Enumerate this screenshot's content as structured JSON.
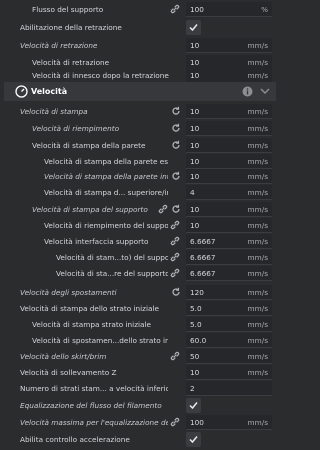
{
  "top": {
    "label": "Flusso del supporto",
    "value": "100",
    "unit": "%"
  },
  "retraction": {
    "enable_label": "Abilitazione della retrazione",
    "speed_label": "Velocità di retrazione",
    "speed_value": "10",
    "speed_unit": "mm/s",
    "retract_speed_label": "Velocità di retrazione",
    "retract_speed_value": "10",
    "retract_speed_unit": "mm/s",
    "prime_speed_label": "Velocità di innesco dopo la retrazione",
    "prime_speed_value": "10",
    "prime_speed_unit": "mm/s"
  },
  "category": {
    "title": "Velocità"
  },
  "settings": [
    {
      "label": "Velocità di stampa",
      "value": "10",
      "unit": "mm/s"
    },
    {
      "label": "Velocità di riempimento",
      "value": "10",
      "unit": "mm/s"
    },
    {
      "label": "Velocità di stampa della parete",
      "value": "10",
      "unit": "mm/s"
    },
    {
      "label": "Velocità di stampa della parete esterna",
      "value": "10",
      "unit": "mm/s"
    },
    {
      "label": "Velocità di stampa della parete interna",
      "value": "10",
      "unit": "mm/s"
    },
    {
      "label": "Velocità di stampa d... superiore/inferiore",
      "value": "4",
      "unit": "mm/s"
    },
    {
      "label": "Velocità di stampa del supporto",
      "value": "10",
      "unit": "mm/s"
    },
    {
      "label": "Velocità di riempimento del supporto",
      "value": "10",
      "unit": "mm/s"
    },
    {
      "label": "Velocità interfaccia supporto",
      "value": "6.6667",
      "unit": "mm/s"
    },
    {
      "label": "Velocità di stam...to) del supporto",
      "value": "6.6667",
      "unit": "mm/s"
    },
    {
      "label": "Velocità di sta...re del supporto",
      "value": "6.6667",
      "unit": "mm/s"
    },
    {
      "label": "Velocità degli spostamenti",
      "value": "120",
      "unit": "mm/s"
    },
    {
      "label": "Velocità di stampa dello strato iniziale",
      "value": "5.0",
      "unit": "mm/s"
    },
    {
      "label": "Velocità di stampa strato iniziale",
      "value": "5.0",
      "unit": "mm/s"
    },
    {
      "label": "Velocità di spostamen...dello strato iniziale",
      "value": "60.0",
      "unit": "mm/s"
    },
    {
      "label": "Velocità dello skirt/brim",
      "value": "50",
      "unit": "mm/s"
    },
    {
      "label": "Velocità di sollevamento Z",
      "value": "10",
      "unit": "mm/s"
    },
    {
      "label": "Numero di strati stam... a velocità inferiore",
      "value": "2",
      "unit": ""
    },
    {
      "label": "Equalizzazione del flusso del filamento"
    },
    {
      "label": "Velocità massima per l'equalizzazione del flusso",
      "value": "100",
      "unit": "mm/s"
    },
    {
      "label": "Abilita controllo accelerazione"
    }
  ]
}
